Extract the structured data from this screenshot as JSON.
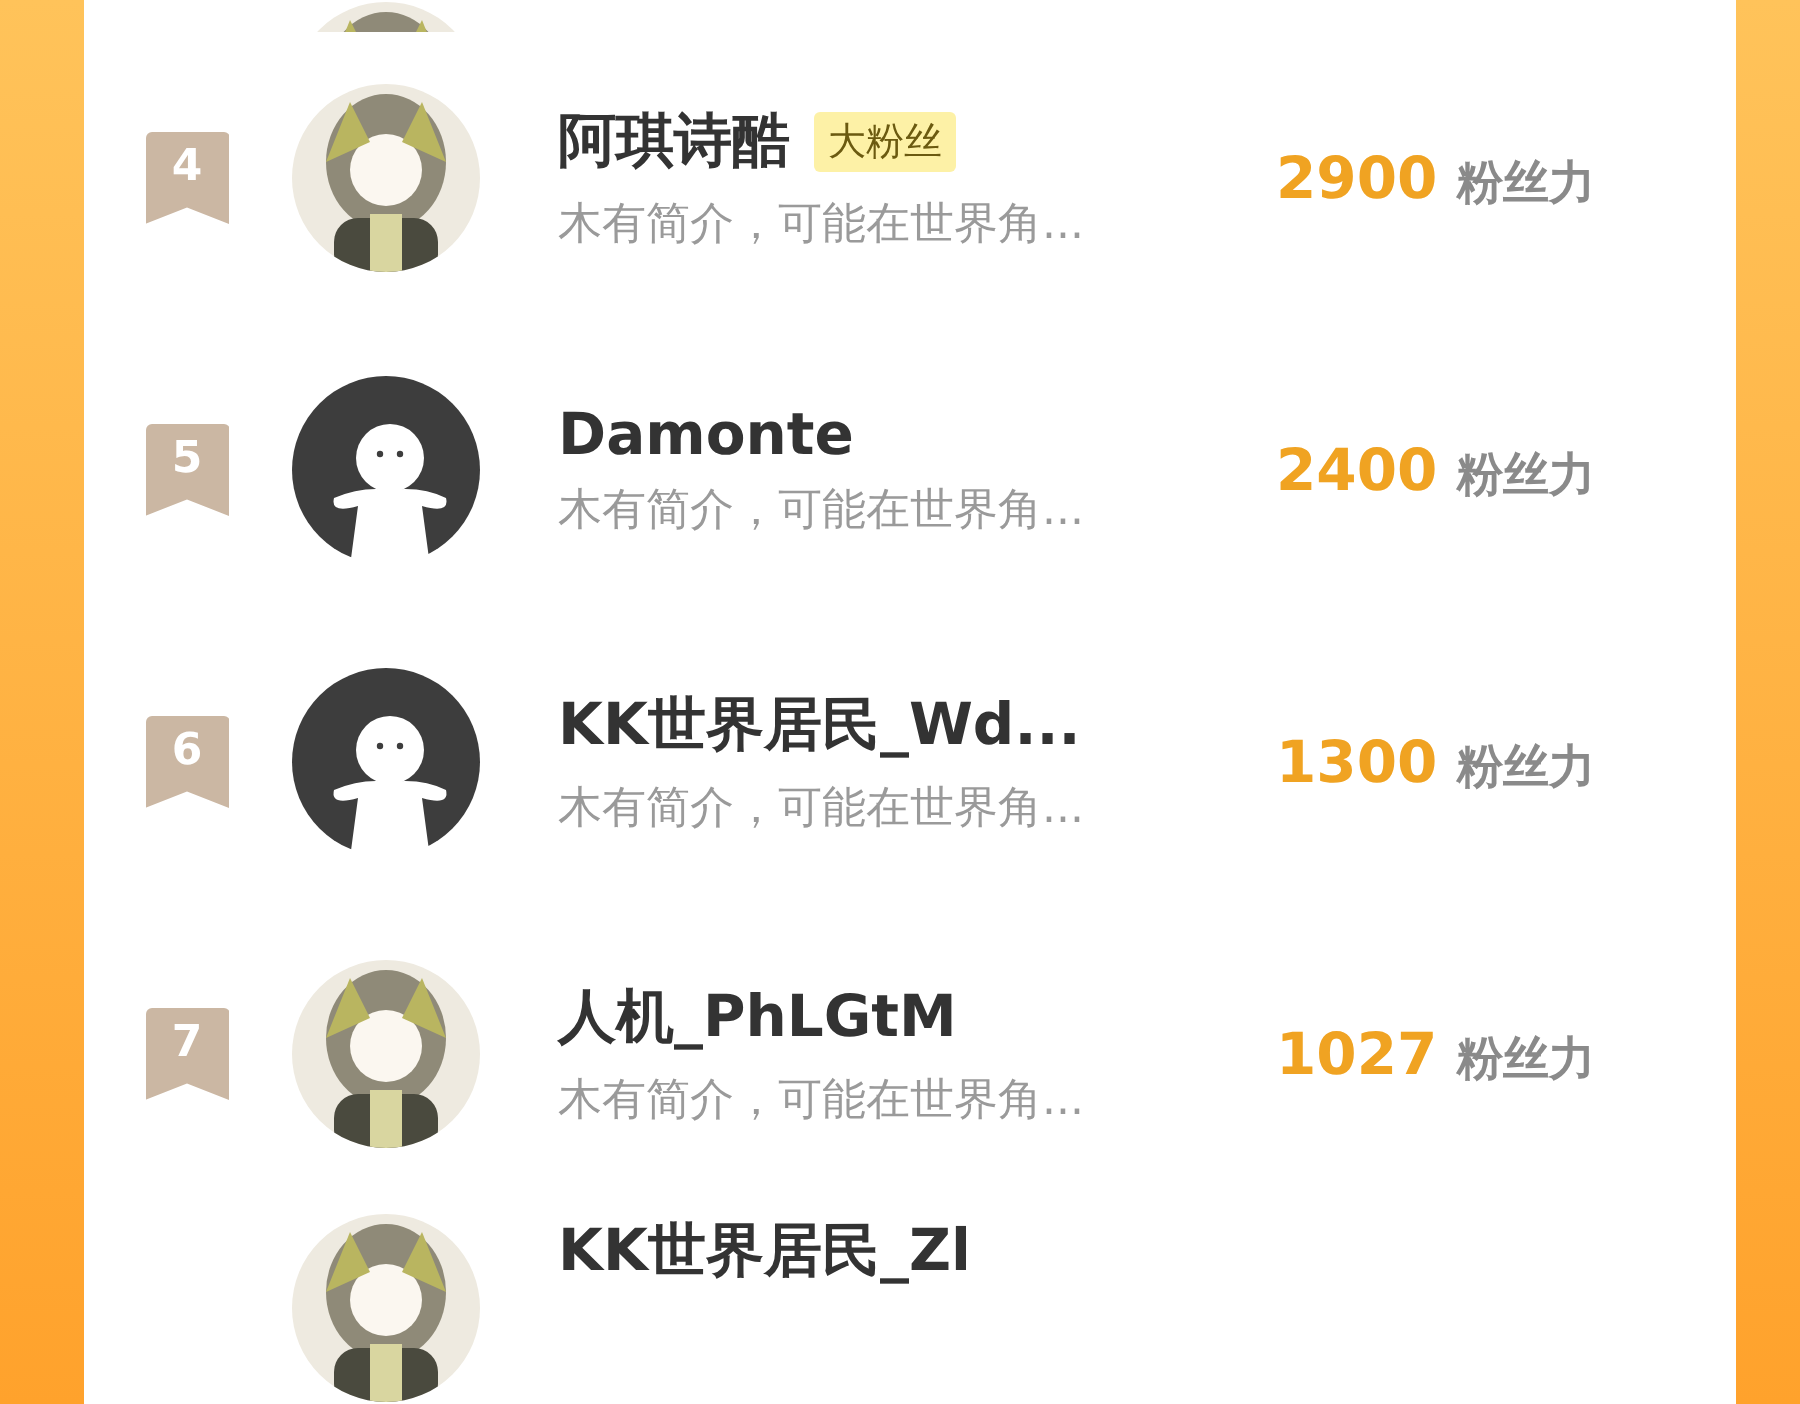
{
  "rows": [
    {
      "rank": "4",
      "name": "阿琪诗酷",
      "tag": "大粉丝",
      "intro": "木有简介，可能在世界角...",
      "score": "2900",
      "unit": "粉丝力"
    },
    {
      "rank": "5",
      "avatar": {
        "kind": "default"
      },
      "name": "Damonte",
      "intro": "木有简介，可能在世界角...",
      "score": "2400",
      "unit": "粉丝力"
    },
    {
      "rank": "6",
      "avatar": {
        "kind": "default"
      },
      "name": "KK世界居民_Wd...",
      "intro": "木有简介，可能在世界角...",
      "score": "1300",
      "unit": "粉丝力"
    },
    {
      "rank": "7",
      "name": "人机_PhLGtM",
      "intro": "木有简介，可能在世界角...",
      "score": "1027",
      "unit": "粉丝力"
    },
    {
      "name": "KK世界居民_Zl"
    }
  ]
}
